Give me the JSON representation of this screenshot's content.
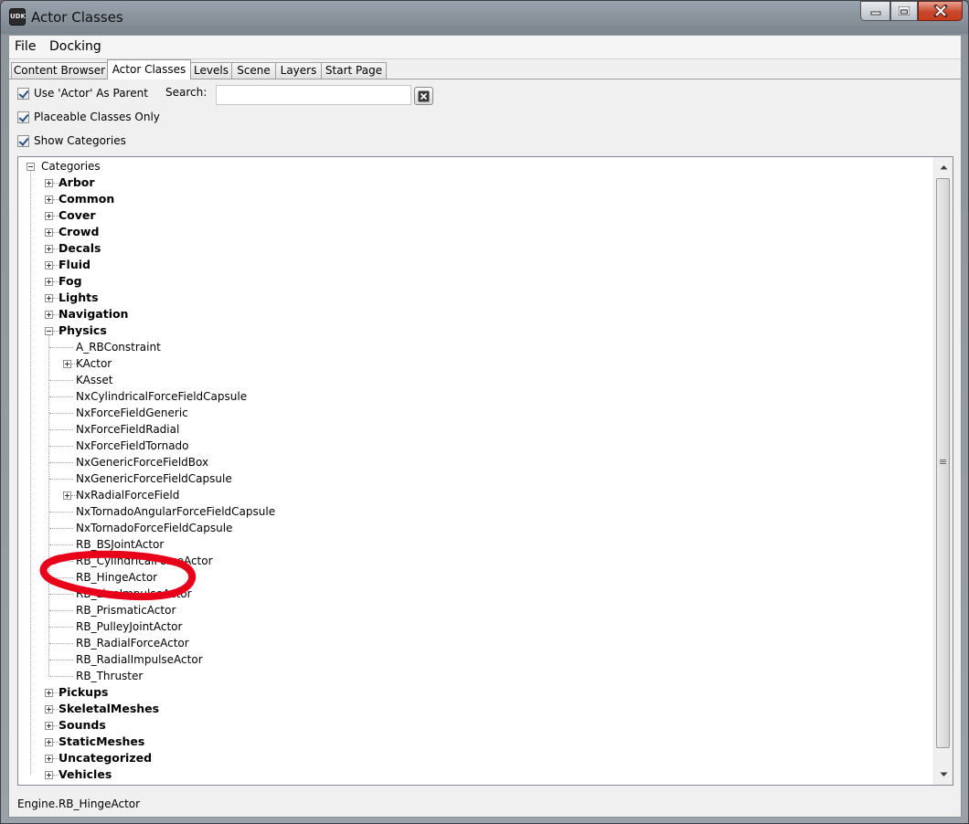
{
  "window": {
    "title": "Actor Classes",
    "icon_text": "UDK"
  },
  "menu": [
    "File",
    "Docking"
  ],
  "tabs": [
    {
      "label": "Content Browser"
    },
    {
      "label": "Actor Classes",
      "active": true
    },
    {
      "label": "Levels"
    },
    {
      "label": "Scene"
    },
    {
      "label": "Layers"
    },
    {
      "label": "Start Page"
    }
  ],
  "options": {
    "use_actor_parent": "Use 'Actor' As Parent",
    "placeable_only": "Placeable Classes Only",
    "show_categories": "Show Categories"
  },
  "search": {
    "label": "Search:",
    "value": "",
    "placeholder": ""
  },
  "tree": {
    "root": "Categories",
    "categories_before": [
      "Arbor",
      "Common",
      "Cover",
      "Crowd",
      "Decals",
      "Fluid",
      "Fog",
      "Lights",
      "Navigation"
    ],
    "expanded": "Physics",
    "physics_children": [
      {
        "label": "A_RBConstraint",
        "expandable": false
      },
      {
        "label": "KActor",
        "expandable": true
      },
      {
        "label": "KAsset",
        "expandable": false
      },
      {
        "label": "NxCylindricalForceFieldCapsule",
        "expandable": false
      },
      {
        "label": "NxForceFieldGeneric",
        "expandable": false
      },
      {
        "label": "NxForceFieldRadial",
        "expandable": false
      },
      {
        "label": "NxForceFieldTornado",
        "expandable": false
      },
      {
        "label": "NxGenericForceFieldBox",
        "expandable": false
      },
      {
        "label": "NxGenericForceFieldCapsule",
        "expandable": false
      },
      {
        "label": "NxRadialForceField",
        "expandable": true
      },
      {
        "label": "NxTornadoAngularForceFieldCapsule",
        "expandable": false
      },
      {
        "label": "NxTornadoForceFieldCapsule",
        "expandable": false
      },
      {
        "label": "RB_BSJointActor",
        "expandable": false
      },
      {
        "label": "RB_CylindricalForceActor",
        "expandable": false
      },
      {
        "label": "RB_HingeActor",
        "expandable": false
      },
      {
        "label": "RB_LineImpulseActor",
        "expandable": false
      },
      {
        "label": "RB_PrismaticActor",
        "expandable": false
      },
      {
        "label": "RB_PulleyJointActor",
        "expandable": false
      },
      {
        "label": "RB_RadialForceActor",
        "expandable": false
      },
      {
        "label": "RB_RadialImpulseActor",
        "expandable": false
      },
      {
        "label": "RB_Thruster",
        "expandable": false
      }
    ],
    "categories_after": [
      "Pickups",
      "SkeletalMeshes",
      "Sounds",
      "StaticMeshes",
      "Uncategorized",
      "Vehicles"
    ],
    "highlighted": "RB_HingeActor"
  },
  "status_text": "Engine.RB_HingeActor",
  "colors": {
    "annotation": "#e8001a",
    "title_text": "#111111",
    "close_button": "#c93d20"
  }
}
